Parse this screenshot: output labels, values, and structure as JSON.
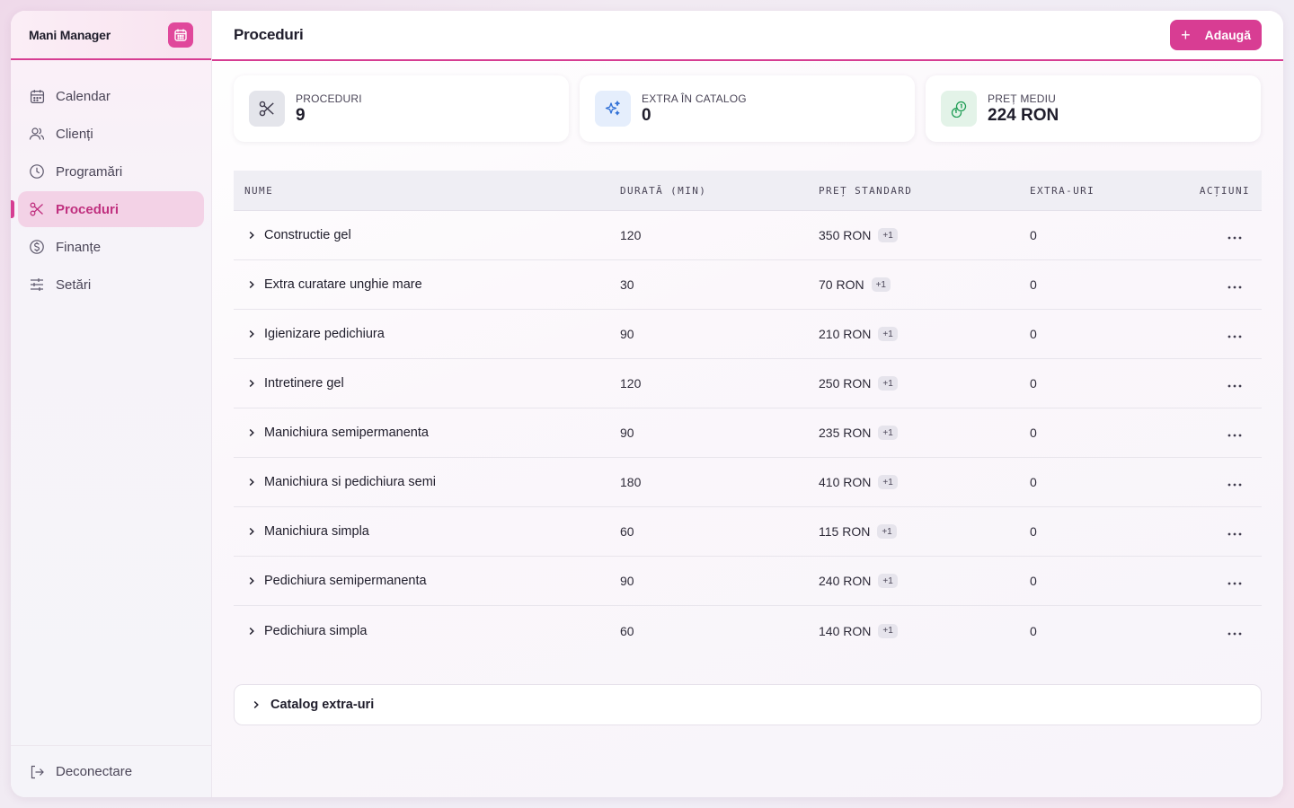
{
  "app": {
    "name": "Mani Manager",
    "icon": "calendar-icon"
  },
  "sidebar": {
    "items": [
      {
        "label": "Calendar",
        "icon": "calendar-icon",
        "active": false
      },
      {
        "label": "Clienți",
        "icon": "users-icon",
        "active": false
      },
      {
        "label": "Programări",
        "icon": "clock-icon",
        "active": false
      },
      {
        "label": "Proceduri",
        "icon": "scissors-icon",
        "active": true
      },
      {
        "label": "Finanțe",
        "icon": "dollar-circle-icon",
        "active": false
      },
      {
        "label": "Setări",
        "icon": "sliders-icon",
        "active": false
      }
    ],
    "logout_label": "Deconectare"
  },
  "header": {
    "title": "Proceduri",
    "add_label": "Adaugă"
  },
  "stats": [
    {
      "label": "PROCEDURI",
      "value": "9",
      "icon": "scissors-icon",
      "bg": "#e4e5eb"
    },
    {
      "label": "EXTRA ÎN CATALOG",
      "value": "0",
      "icon": "sparkles-icon",
      "bg": "#e5eefc"
    },
    {
      "label": "PREȚ MEDIU",
      "value": "224 RON",
      "icon": "coins-icon",
      "bg": "#e3f3e8"
    }
  ],
  "table": {
    "columns": [
      "NUME",
      "DURATĂ (MIN)",
      "PREȚ STANDARD",
      "EXTRA-URI",
      "ACȚIUNI"
    ],
    "rows": [
      {
        "name": "Constructie gel",
        "duration": "120",
        "price": "350 RON",
        "badge": "+1",
        "extras": "0"
      },
      {
        "name": "Extra curatare unghie mare",
        "duration": "30",
        "price": "70 RON",
        "badge": "+1",
        "extras": "0"
      },
      {
        "name": "Igienizare pedichiura",
        "duration": "90",
        "price": "210 RON",
        "badge": "+1",
        "extras": "0"
      },
      {
        "name": "Intretinere gel",
        "duration": "120",
        "price": "250 RON",
        "badge": "+1",
        "extras": "0"
      },
      {
        "name": "Manichiura semipermanenta",
        "duration": "90",
        "price": "235 RON",
        "badge": "+1",
        "extras": "0"
      },
      {
        "name": "Manichiura si pedichiura semi",
        "duration": "180",
        "price": "410 RON",
        "badge": "+1",
        "extras": "0"
      },
      {
        "name": "Manichiura simpla",
        "duration": "60",
        "price": "115 RON",
        "badge": "+1",
        "extras": "0"
      },
      {
        "name": "Pedichiura semipermanenta",
        "duration": "90",
        "price": "240 RON",
        "badge": "+1",
        "extras": "0"
      },
      {
        "name": "Pedichiura simpla",
        "duration": "60",
        "price": "140 RON",
        "badge": "+1",
        "extras": "0"
      }
    ]
  },
  "catalog": {
    "label": "Catalog extra-uri"
  },
  "colors": {
    "accent": "#d63d92",
    "active_bg": "#f3d2e6"
  }
}
